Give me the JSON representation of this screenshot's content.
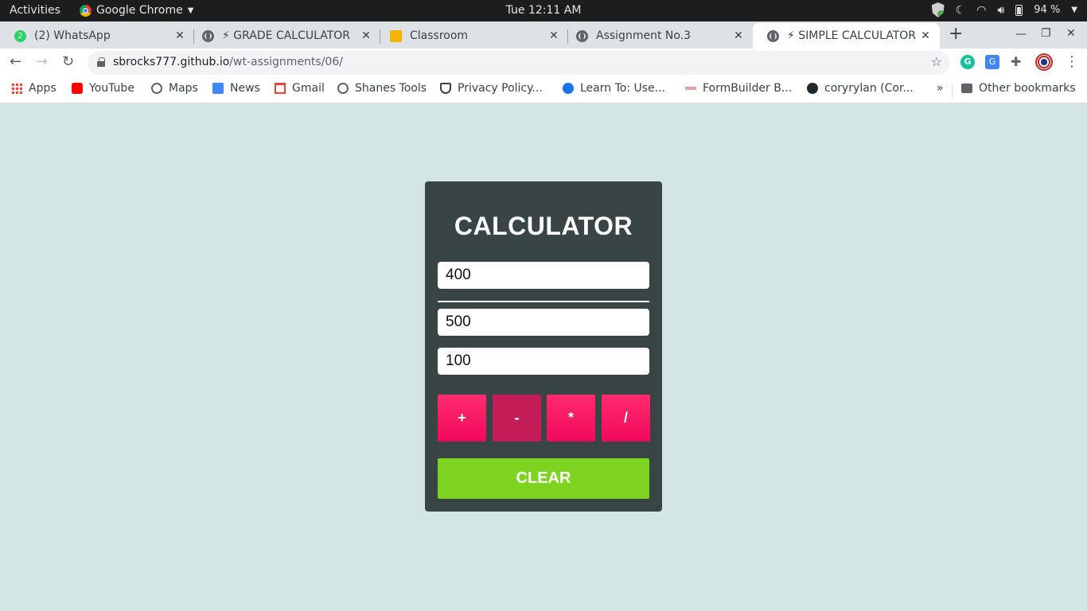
{
  "system": {
    "activities": "Activities",
    "app_name": "Google Chrome",
    "clock": "Tue 12:11 AM",
    "battery": "94 %"
  },
  "tabs": [
    {
      "title": "(2) WhatsApp",
      "badge": "2"
    },
    {
      "title": "⚡ GRADE CALCULATOR"
    },
    {
      "title": "Classroom"
    },
    {
      "title": "Assignment No.3"
    },
    {
      "title": "⚡ SIMPLE CALCULATOR",
      "active": true
    }
  ],
  "address": {
    "domain": "sbrocks777.github.io",
    "path": "/wt-assignments/06/"
  },
  "bookmarks": [
    "Apps",
    "YouTube",
    "Maps",
    "News",
    "Gmail",
    "Shanes Tools",
    "Privacy Policy...",
    "Learn To: Use...",
    "FormBuilder B...",
    "coryrylan (Cor..."
  ],
  "bookmarks_overflow": "»",
  "other_bookmarks": "Other bookmarks",
  "calculator": {
    "title": "CALCULATOR",
    "input1": "400",
    "input2": "500",
    "result": "100",
    "ops": [
      "+",
      "-",
      "*",
      "/"
    ],
    "clear_label": "CLEAR",
    "colors": {
      "panel": "#394444",
      "operator": "#f10a5c",
      "operator_active": "#c41c56",
      "clear": "#7ed321",
      "background": "#d3e5e5"
    }
  }
}
